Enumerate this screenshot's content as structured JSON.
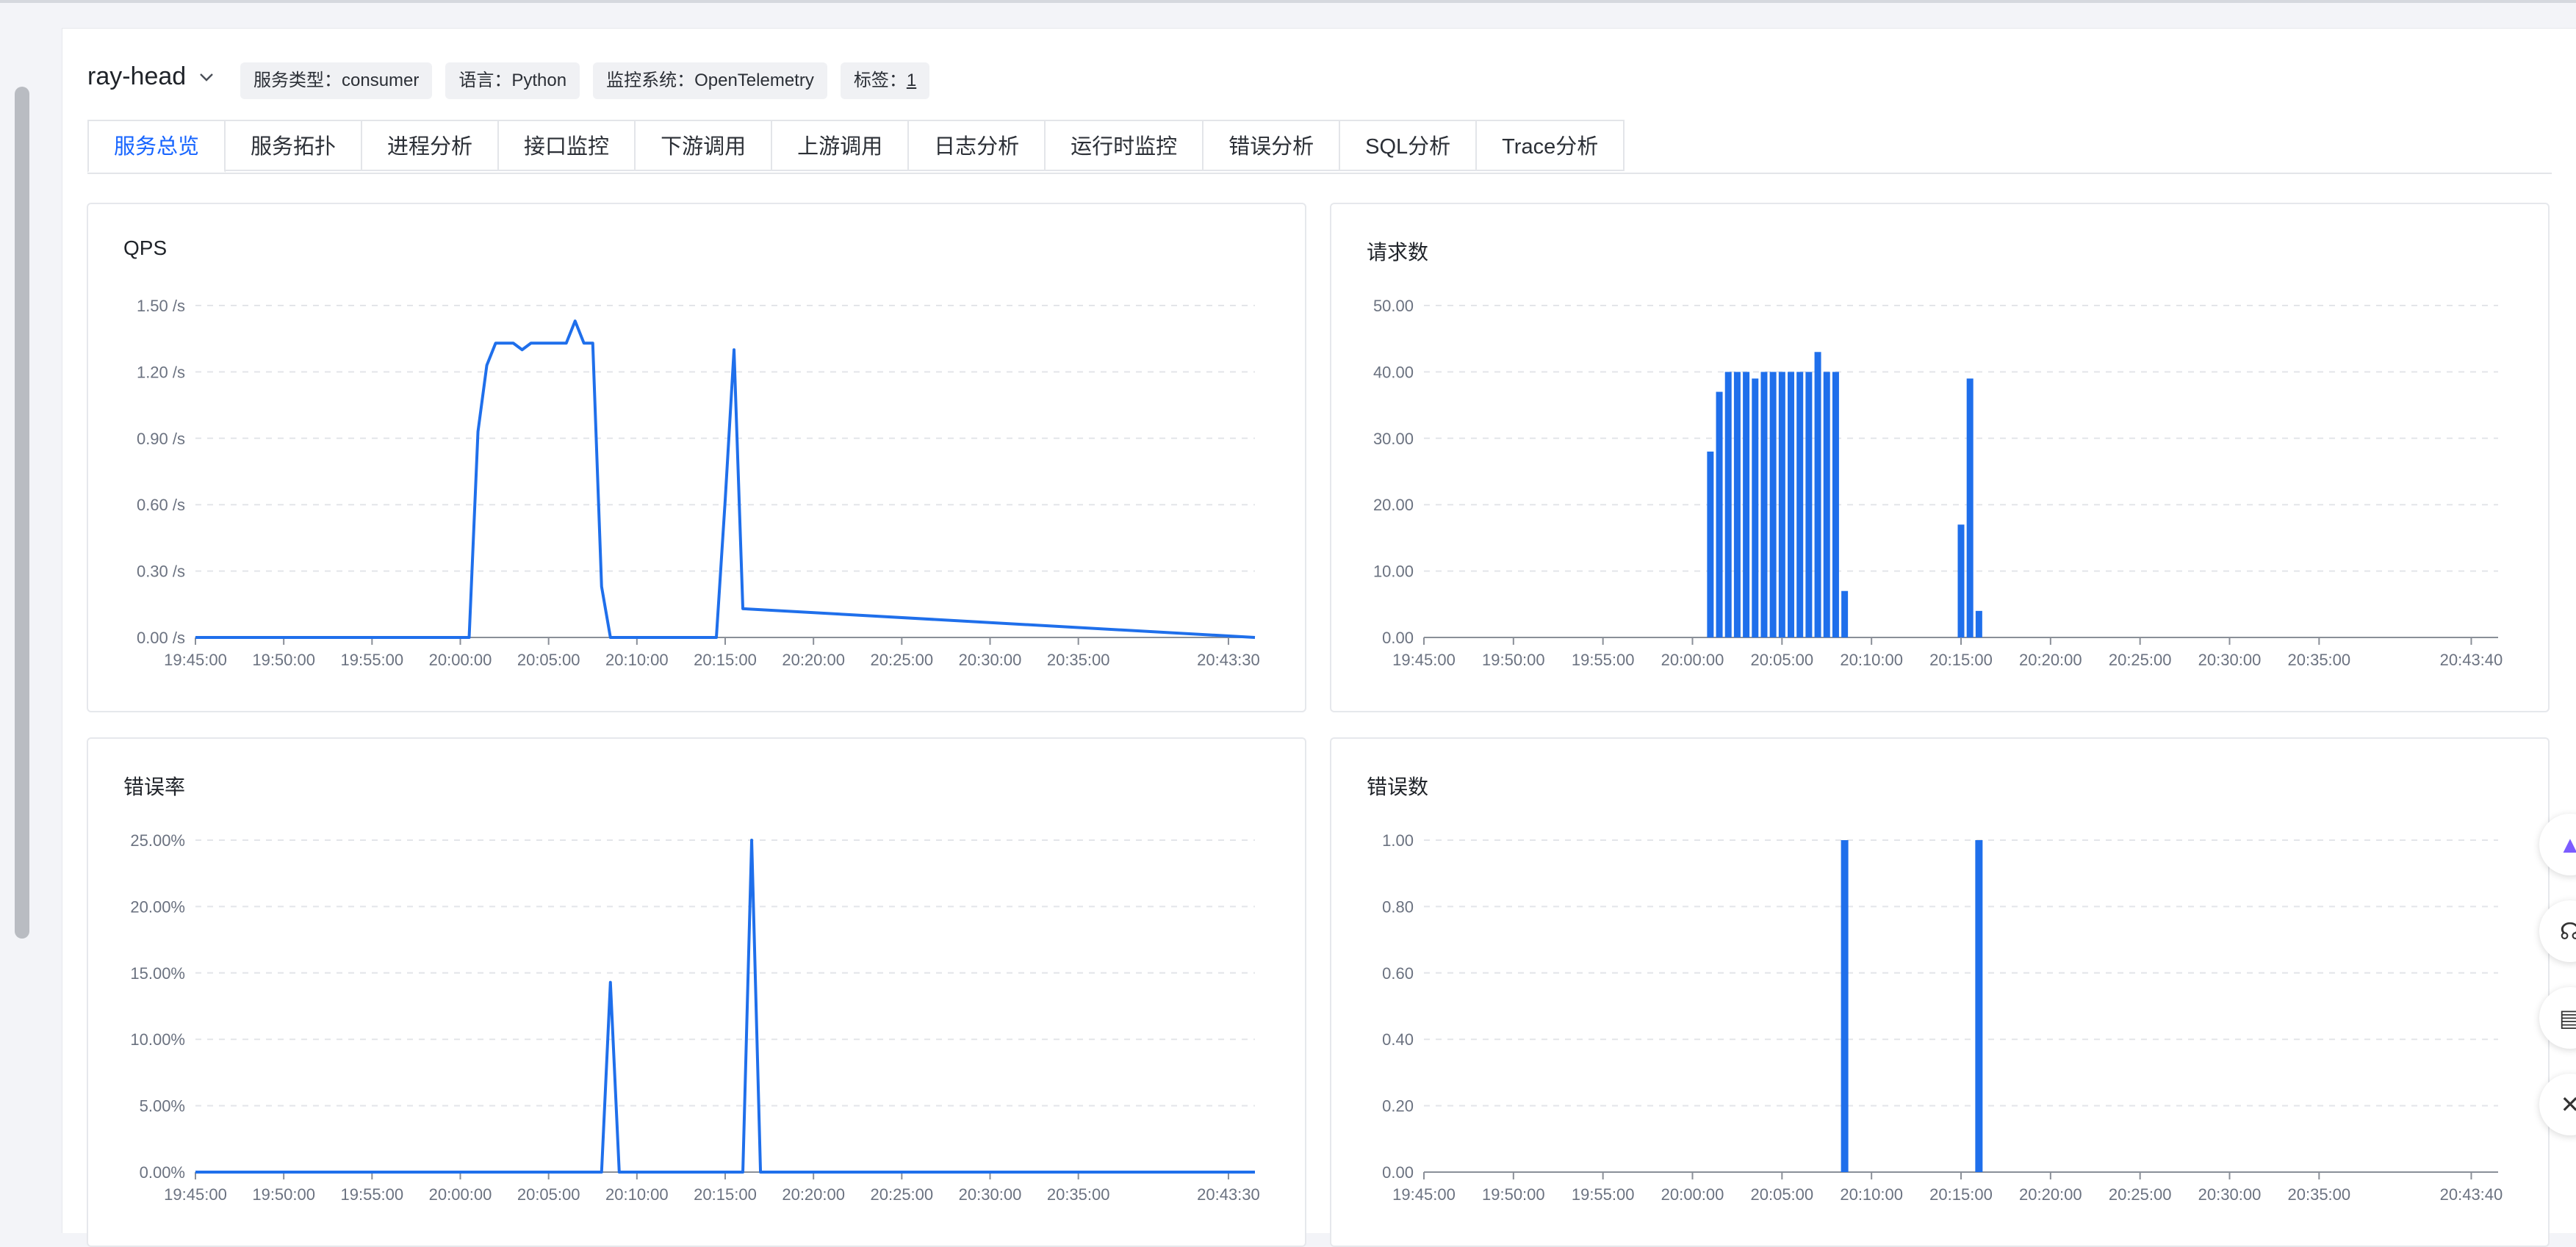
{
  "service": {
    "name": "ray-head",
    "tags": [
      {
        "label": "服务类型：consumer"
      },
      {
        "label": "语言：Python"
      },
      {
        "label": "监控系统：OpenTelemetry"
      },
      {
        "label_prefix": "标签：",
        "label_value": "1"
      }
    ]
  },
  "tabs": [
    {
      "label": "服务总览",
      "active": true
    },
    {
      "label": "服务拓扑"
    },
    {
      "label": "进程分析"
    },
    {
      "label": "接口监控"
    },
    {
      "label": "下游调用"
    },
    {
      "label": "上游调用"
    },
    {
      "label": "日志分析"
    },
    {
      "label": "运行时监控"
    },
    {
      "label": "错误分析"
    },
    {
      "label": "SQL分析"
    },
    {
      "label": "Trace分析"
    }
  ],
  "colors": {
    "accent": "#1664ff",
    "series": "#1f6feb"
  },
  "chart_data": [
    {
      "title": "QPS",
      "type": "line",
      "ylim": [
        0,
        1.5
      ],
      "yticks": [
        "0.00 /s",
        "0.30 /s",
        "0.60 /s",
        "0.90 /s",
        "1.20 /s",
        "1.50 /s"
      ],
      "xlabels": [
        "19:45:00",
        "19:50:00",
        "19:55:00",
        "20:00:00",
        "20:05:00",
        "20:10:00",
        "20:15:00",
        "20:20:00",
        "20:25:00",
        "20:30:00",
        "20:35:00",
        "20:43:30"
      ],
      "x": [
        0,
        15.5,
        16.0,
        16.5,
        17.0,
        17.5,
        18.0,
        18.5,
        19.0,
        19.5,
        20.0,
        20.5,
        21.0,
        21.5,
        22.0,
        22.5,
        23.0,
        23.5,
        24.0,
        29.5,
        30.0,
        30.5,
        31.0,
        60.0
      ],
      "y": [
        0,
        0,
        0.93,
        1.23,
        1.33,
        1.33,
        1.33,
        1.3,
        1.33,
        1.33,
        1.33,
        1.33,
        1.33,
        1.43,
        1.33,
        1.33,
        0.23,
        0,
        0,
        0,
        0.62,
        1.3,
        0.13,
        0
      ]
    },
    {
      "title": "请求数",
      "type": "bar",
      "ylim": [
        0,
        50
      ],
      "yticks": [
        "0.00",
        "10.00",
        "20.00",
        "30.00",
        "40.00",
        "50.00"
      ],
      "xlabels": [
        "19:45:00",
        "19:50:00",
        "19:55:00",
        "20:00:00",
        "20:05:00",
        "20:10:00",
        "20:15:00",
        "20:20:00",
        "20:25:00",
        "20:30:00",
        "20:35:00",
        "20:43:40"
      ],
      "x": [
        16.0,
        16.5,
        17.0,
        17.5,
        18.0,
        18.5,
        19.0,
        19.5,
        20.0,
        20.5,
        21.0,
        21.5,
        22.0,
        22.5,
        23.0,
        30.0,
        30.5,
        31.0
      ],
      "values": [
        28,
        37,
        40,
        40,
        40,
        39,
        40,
        40,
        40,
        40,
        40,
        40,
        43,
        40,
        40,
        17,
        39,
        4,
        7
      ],
      "x_extra": [
        23.5
      ]
    },
    {
      "title": "错误率",
      "type": "line",
      "ylim": [
        0,
        25
      ],
      "yticks": [
        "0.00%",
        "5.00%",
        "10.00%",
        "15.00%",
        "20.00%",
        "25.00%"
      ],
      "xlabels": [
        "19:45:00",
        "19:50:00",
        "19:55:00",
        "20:00:00",
        "20:05:00",
        "20:10:00",
        "20:15:00",
        "20:20:00",
        "20:25:00",
        "20:30:00",
        "20:35:00",
        "20:43:30"
      ],
      "x": [
        0,
        23.0,
        23.5,
        24.0,
        31.0,
        31.5,
        32.0,
        60.0
      ],
      "y": [
        0,
        0,
        14.29,
        0,
        0,
        25,
        0,
        0
      ]
    },
    {
      "title": "错误数",
      "type": "bar",
      "ylim": [
        0,
        1
      ],
      "yticks": [
        "0.00",
        "0.20",
        "0.40",
        "0.60",
        "0.80",
        "1.00"
      ],
      "xlabels": [
        "19:45:00",
        "19:50:00",
        "19:55:00",
        "20:00:00",
        "20:05:00",
        "20:10:00",
        "20:15:00",
        "20:20:00",
        "20:25:00",
        "20:30:00",
        "20:35:00",
        "20:43:40"
      ],
      "x": [
        23.5,
        31.0
      ],
      "values": [
        1,
        1
      ]
    }
  ],
  "side_buttons": [
    {
      "icon": "app-logo-icon"
    },
    {
      "icon": "headset-icon"
    },
    {
      "icon": "document-icon"
    },
    {
      "icon": "close-icon"
    }
  ]
}
